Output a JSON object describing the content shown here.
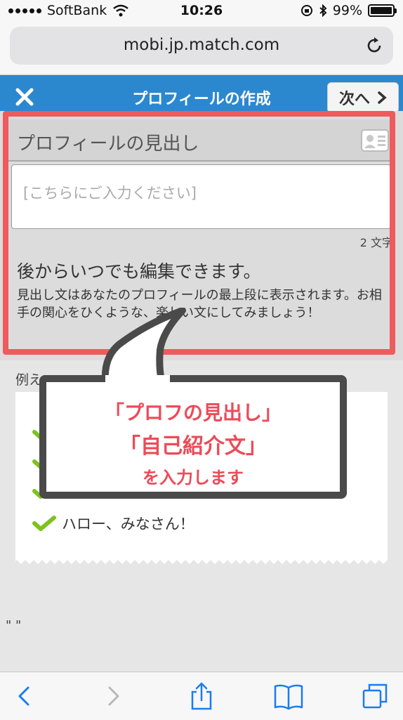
{
  "status_bar": {
    "carrier": "SoftBank",
    "time": "10:26",
    "battery": "99%",
    "battery_level": 0.99
  },
  "browser": {
    "url": "mobi.jp.match.com"
  },
  "app_header": {
    "title": "プロフィールの作成",
    "next_label": "次へ"
  },
  "section": {
    "title": "プロフィールの見出し",
    "input_placeholder": "[こちらにご入力ください]",
    "char_count": "2 文字",
    "sub_heading": "後からいつでも編集できます。",
    "description": "見出し文はあなたのプロフィールの最上段に表示されます。お相手の関心をひくような、楽しい文にしてみましょう！"
  },
  "examples": {
    "label": "例え",
    "items": [
      "ハロー、みなさん！"
    ]
  },
  "callout": {
    "line1": "「プロフの見出し」",
    "line2": "「自己紹介文」",
    "line3": "を入力します"
  },
  "stray_text": "\" \"",
  "colors": {
    "header_blue": "#2b88cf",
    "highlight_red": "#ef5a5d",
    "callout_text": "#ec4b58",
    "check_green": "#7dc21e",
    "ios_blue": "#1a7cf0"
  },
  "icons": [
    "reload-icon",
    "close-icon",
    "chevron-right-icon",
    "profile-card-icon",
    "check-icon",
    "back-arrow-icon",
    "forward-arrow-icon",
    "share-icon",
    "bookmarks-icon",
    "tabs-icon"
  ]
}
